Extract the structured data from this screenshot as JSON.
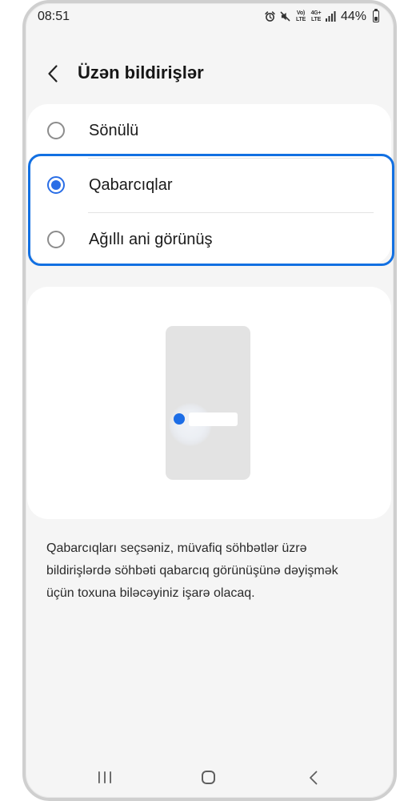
{
  "status_bar": {
    "time": "08:51",
    "volte_label_top": "Vo)",
    "volte_label_bottom": "LTE",
    "network_label_top": "4G+",
    "network_label_bottom": "LTE",
    "battery_percent": "44%",
    "battery_level": 0.44,
    "icons": [
      "alarm-icon",
      "mute-icon",
      "volte-icon",
      "network-4g-icon",
      "signal-icon",
      "battery-icon"
    ]
  },
  "header": {
    "back_icon": "chevron-left-icon",
    "title": "Üzən bildirişlər"
  },
  "options": [
    {
      "label": "Sönülü",
      "selected": false
    },
    {
      "label": "Qabarcıqlar",
      "selected": true
    },
    {
      "label": "Ağıllı ani görünüş",
      "selected": false
    }
  ],
  "illustration": {
    "icon": "bubble-notification-illustration"
  },
  "description": "Qabarcıqları seçsəniz, müvafiq söhbətlər üzrə bildirişlərdə söhbəti qabarcıq görünüşünə dəyişmək üçün toxuna biləcəyiniz işarə olacaq.",
  "nav_bar": {
    "icons": [
      "recent-apps-icon",
      "home-icon",
      "back-icon"
    ]
  },
  "colors": {
    "accent": "#2a6ee6",
    "highlight": "#1270e2",
    "screen_background": "#f5f5f5",
    "card_background": "#ffffff",
    "frame": "#cfcfcf"
  }
}
